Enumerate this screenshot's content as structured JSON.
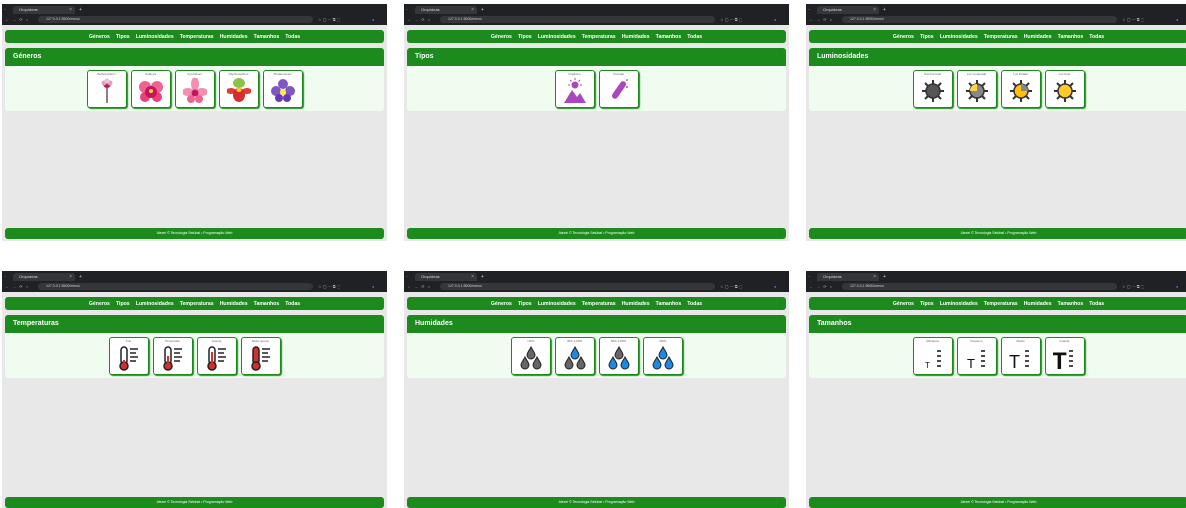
{
  "browser": {
    "tab_title": "Orquídeas",
    "url": "127.0.0.1:5500/menu/"
  },
  "menu": [
    "Géneros",
    "Tipos",
    "Luminosidades",
    "Temperaturas",
    "Humidades",
    "Tamanhos",
    "Todas"
  ],
  "footer": "Alexei © Tecnologia Setúbal • Programação Web",
  "screens": [
    {
      "title": "Géneros",
      "labels": [
        "Bulbophyllum",
        "Cattleya",
        "Cymbidium",
        "Paphiopedilum",
        "Phalaenopsis"
      ]
    },
    {
      "title": "Tipos",
      "labels": [
        "Orgânico",
        "Clonado"
      ]
    },
    {
      "title": "Luminosidades",
      "labels": [
        "Sombra total",
        "Luz moderada",
        "Luz filtrada",
        "Luz forte"
      ]
    },
    {
      "title": "Temperaturas",
      "labels": [
        "Frio",
        "Temperado",
        "Quente",
        "Muito quente"
      ]
    },
    {
      "title": "Humidades",
      "labels": [
        "<40%",
        "40% a 60%",
        "60% a 80%",
        ">80%"
      ]
    },
    {
      "title": "Tamanhos",
      "labels": [
        "Miniatura",
        "Pequeno",
        "Médio",
        "Grande"
      ]
    }
  ],
  "colors": {
    "accent": "#1d8a1d",
    "panel": "#effcef",
    "background": "#e8e8e8"
  }
}
